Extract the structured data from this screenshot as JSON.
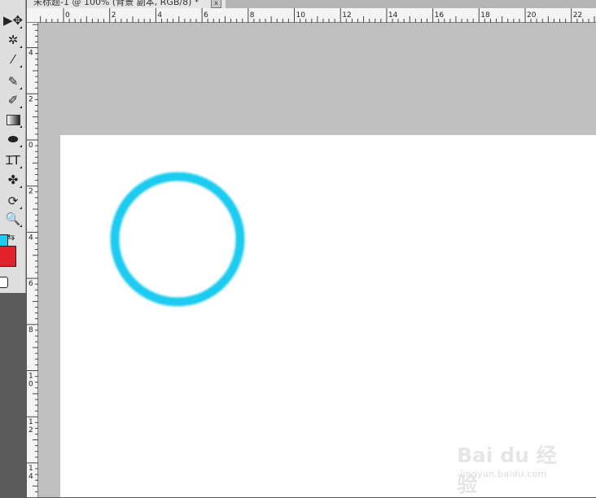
{
  "document": {
    "tab_title": "未标题-1 @ 100% (背景 副本, RGB/8) *",
    "close_label": "x"
  },
  "toolbar": {
    "tools": [
      {
        "name": "move-tool",
        "icon": "move-icon",
        "glyph": "▶✥"
      },
      {
        "name": "magic-wand-tool",
        "icon": "magic-wand-icon",
        "glyph": "✲"
      },
      {
        "name": "eyedropper-tool",
        "icon": "eyedropper-icon",
        "glyph": "⁄"
      },
      {
        "name": "brush-tool",
        "icon": "brush-icon",
        "glyph": "✎"
      },
      {
        "name": "history-brush-tool",
        "icon": "history-brush-icon",
        "glyph": "✐"
      },
      {
        "name": "gradient-tool",
        "icon": "gradient-icon",
        "glyph": ""
      },
      {
        "name": "blur-tool",
        "icon": "blur-icon",
        "glyph": "⬬"
      },
      {
        "name": "type-tool",
        "icon": "type-icon",
        "glyph": "ꞮT"
      },
      {
        "name": "custom-shape-tool",
        "icon": "shape-icon",
        "glyph": "✤"
      },
      {
        "name": "3d-rotate-tool",
        "icon": "3d-rotate-icon",
        "glyph": "⟳"
      },
      {
        "name": "zoom-tool",
        "icon": "zoom-icon",
        "glyph": "🔍"
      }
    ],
    "foreground_color": "#1ecbf0",
    "background_color": "#e3222b"
  },
  "rulers": {
    "top_labels": [
      "0",
      "2",
      "4",
      "6",
      "8",
      "10",
      "12",
      "14",
      "16",
      "18",
      "20",
      "22"
    ],
    "left_labels": [
      "4",
      "2",
      "0",
      "2",
      "4",
      "6",
      "8",
      "1\n0",
      "1\n2",
      "1\n4"
    ]
  },
  "canvas": {
    "ring_color": "#1ecbf0",
    "document_color": "#ffffff",
    "pasteboard_color": "#c0c0c0"
  },
  "watermark": {
    "main": "Bai du 经验",
    "sub": "jingyan.baidu.com"
  }
}
